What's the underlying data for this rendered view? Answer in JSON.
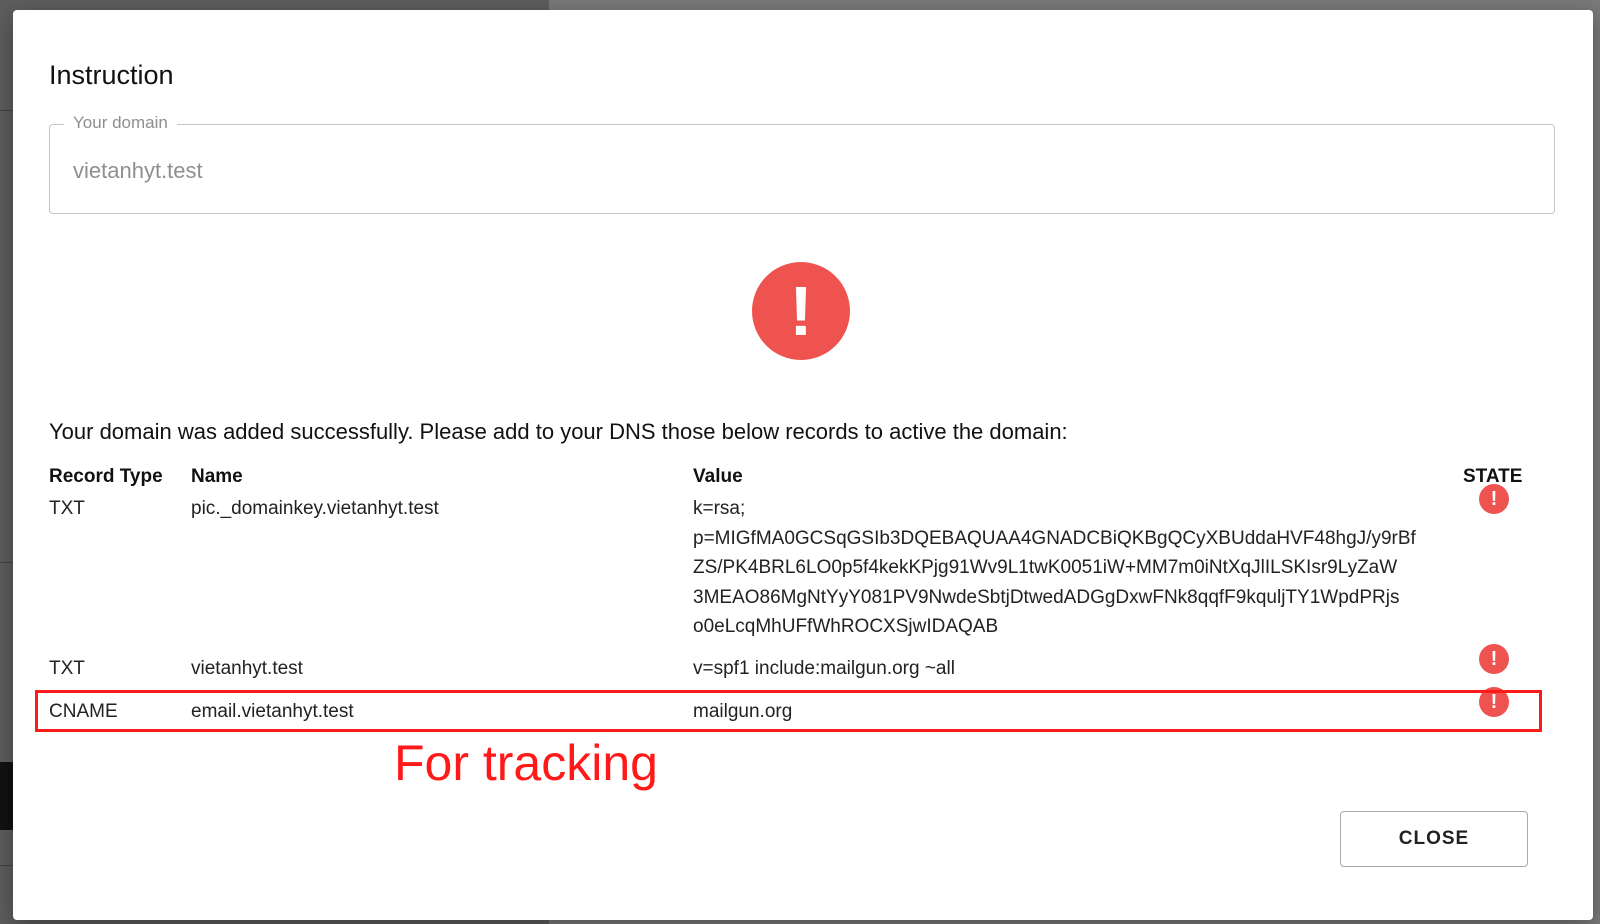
{
  "dialog": {
    "title": "Instruction",
    "domain_field": {
      "label": "Your domain",
      "value": "vietanhyt.test"
    },
    "status_icon": "exclamation-circle-icon",
    "message": "Your domain was added successfully. Please add to your DNS those below records to active the domain:",
    "table": {
      "headers": [
        "Record Type",
        "Name",
        "Value",
        "STATE"
      ],
      "rows": [
        {
          "type": "TXT",
          "name": "pic._domainkey.vietanhyt.test",
          "value": "k=rsa; p=MIGfMA0GCSqGSIb3DQEBAQUAA4GNADCBiQKBgQCyXBUddaHVF48hgJ/y9rBfZS/PK4BRL6LO0p5f4kekKPjg91Wv9L1twK0051iW+MM7m0iNtXqJlILSKIsr9LyZaW3MEAO86MgNtYyY081PV9NwdeSbtjDtwedADGgDxwFNk8qqfF9kqulj TY1WpdPRjso0eLcqMhUFfWhROCXSjwIDAQAB",
          "value_lines": [
            "k=rsa;",
            "p=MIGfMA0GCSqGSIb3DQEBAQUAA4GNADCBiQKBgQCyXBUddaHVF48hgJ/y9rBf",
            "ZS/PK4BRL6LO0p5f4kekKPjg91Wv9L1twK0051iW+MM7m0iNtXqJlILSKIsr9LyZaW",
            "3MEAO86MgNtYyY081PV9NwdeSbtjDtwedADGgDxwFNk8qqfF9kquljTY1WpdPRjs",
            "o0eLcqMhUFfWhROCXSjwIDAQAB"
          ],
          "state_icon": "exclamation-circle-icon",
          "state": "error"
        },
        {
          "type": "TXT",
          "name": "vietanhyt.test",
          "value_lines": [
            "v=spf1 include:mailgun.org ~all"
          ],
          "state_icon": "exclamation-circle-icon",
          "state": "error"
        },
        {
          "type": "CNAME",
          "name": "email.vietanhyt.test",
          "value_lines": [
            "mailgun.org"
          ],
          "state_icon": "exclamation-circle-icon",
          "state": "error"
        }
      ]
    },
    "annotation": "For tracking",
    "close_label": "CLOSE"
  },
  "colors": {
    "error": "#ef5350",
    "annotation": "#ff1a1a"
  }
}
